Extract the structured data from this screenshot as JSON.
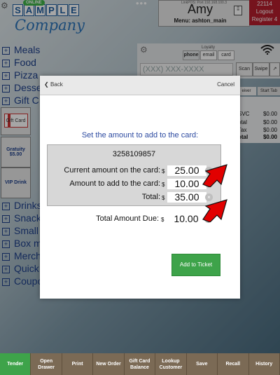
{
  "header": {
    "logo_text": "SAMPLE",
    "logo_company": "Company",
    "online_badge": "ONLINE",
    "link_info": "LinkPOS: Port 192.168.100.3",
    "user_name": "Amy",
    "menu_line": "Menu: ashton_main",
    "register_number": "22114",
    "logout_label": "Logout",
    "register_label": "Register 4"
  },
  "categories_top": [
    "Meals",
    "Food",
    "Pizza",
    "Desse",
    "Gift C"
  ],
  "tiles": {
    "gift_card": "Gift Card",
    "gratuity_title": "Gratuity",
    "gratuity_amount": "$5.00",
    "vip_drink": "VIP Drink"
  },
  "categories_bottom": [
    "Drinks",
    "Snack",
    "Small",
    "Box m",
    "Merch",
    "Quick",
    "Coupo"
  ],
  "loyalty": {
    "label": "Loyalty",
    "segments": [
      "phone",
      "email",
      "card"
    ],
    "selected_segment": "phone",
    "phone_placeholder": "(XXX) XXX-XXXX",
    "scan_label": "Scan",
    "swipe_label": "Swipe",
    "expand_label": "↗"
  },
  "right_tabs": [
    "eiver",
    "Start Tab"
  ],
  "totals": [
    {
      "label": "SVC",
      "value": "$0.00"
    },
    {
      "label": "otal",
      "value": "$0.00"
    },
    {
      "label": "Tax",
      "value": "$0.00"
    },
    {
      "label": "otal",
      "value": "$0.00"
    }
  ],
  "toolbar": [
    {
      "label": "Tender"
    },
    {
      "label": "Open Drawer"
    },
    {
      "label": "Print"
    },
    {
      "label": "New Order"
    },
    {
      "label": "Gift Card Balance"
    },
    {
      "label": "Lookup Customer"
    },
    {
      "label": "Save"
    },
    {
      "label": "Recall"
    },
    {
      "label": "History"
    }
  ],
  "modal": {
    "back_label": "Back",
    "cancel_label": "Cancel",
    "title": "Set the amount to add to the card:",
    "card_number": "3258109857",
    "rows": [
      {
        "label": "Current amount on the card:",
        "currency": "$",
        "value": "25.00"
      },
      {
        "label": "Amount to add to the card:",
        "currency": "$",
        "value": "10.00"
      },
      {
        "label": "Total:",
        "currency": "$",
        "value": "35.00"
      }
    ],
    "total_due": {
      "label": "Total Amount Due:",
      "currency": "$",
      "value": "10.00"
    },
    "add_button": "Add to Ticket"
  },
  "colors": {
    "accent_blue": "#2c4aa0",
    "category_blue": "#1e3f8a",
    "register_red": "#b51e2d",
    "tender_green": "#3ea34a",
    "arrow_red": "#e10000"
  }
}
